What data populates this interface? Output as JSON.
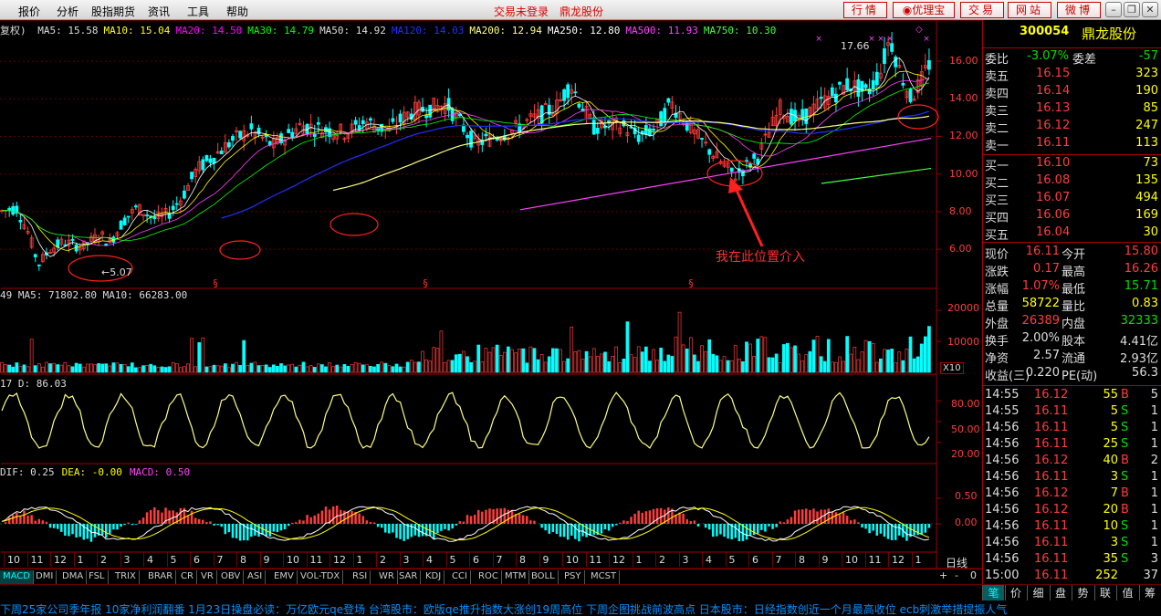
{
  "menu": [
    "报价",
    "分析",
    "股指期货",
    "资讯",
    "工具",
    "帮助"
  ],
  "header": {
    "login_status": "交易未登录",
    "stock_name": "鼎龙股份"
  },
  "toolbar": {
    "quote": "行情",
    "logo": "优理宝",
    "trade": "交易",
    "site": "网站",
    "weibo": "微博"
  },
  "ma_line": [
    {
      "text": "复权) ",
      "color": "#dddddd"
    },
    {
      "text": "MA5: 15.58",
      "color": "#dddddd"
    },
    {
      "text": "MA10: 15.04",
      "color": "#ffff00"
    },
    {
      "text": "MA20: 14.50",
      "color": "#ff00ff"
    },
    {
      "text": "MA30: 14.79",
      "color": "#00ff00"
    },
    {
      "text": "MA50: 14.92",
      "color": "#dddddd"
    },
    {
      "text": "MA120: 14.03",
      "color": "#2030ff"
    },
    {
      "text": "MA200: 12.94",
      "color": "#ffff80"
    },
    {
      "text": "MA250: 12.80",
      "color": "#ffffff"
    },
    {
      "text": "MA500: 11.93",
      "color": "#ff40ff"
    },
    {
      "text": "MA750: 10.30",
      "color": "#40ff40"
    }
  ],
  "price_axis": [
    "16.00",
    "14.00",
    "12.00",
    "10.00",
    "8.00",
    "6.00"
  ],
  "high_label": "17.66",
  "low_label": "5.07",
  "annotation": "我在此位置介入",
  "vol_line": "49  MA5: 71802.80  MA10: 66283.00",
  "vol_axis": [
    "20000",
    "10000"
  ],
  "vol_unit": "X10",
  "kdj_line": "17  D: 86.03",
  "kdj_axis": [
    "80.00",
    "50.00",
    "20.00"
  ],
  "macd_line": [
    {
      "text": "DIF: 0.25",
      "color": "#dddddd"
    },
    {
      "text": "DEA: -0.00",
      "color": "#ffff00"
    },
    {
      "text": "MACD: 0.50",
      "color": "#ff40ff"
    }
  ],
  "macd_axis": [
    "0.50",
    "0.00"
  ],
  "months": [
    "10",
    "11",
    "12",
    "1",
    "2",
    "3",
    "4",
    "5",
    "6",
    "7",
    "8",
    "9",
    "10",
    "11",
    "12",
    "1",
    "2",
    "3",
    "4",
    "5",
    "6",
    "7",
    "8",
    "9",
    "10",
    "11",
    "12",
    "1",
    "2",
    "3",
    "4",
    "5",
    "6",
    "7",
    "8",
    "9",
    "10",
    "11",
    "12",
    "1"
  ],
  "period_label": "日线",
  "bottom_tabs": [
    "MACD",
    "DMI",
    "DMA",
    "FSL",
    "TRIX",
    "BRAR",
    "CR",
    "VR",
    "OBV",
    "ASI",
    "EMV",
    "VOL-TDX",
    "RSI",
    "WR",
    "SAR",
    "KDJ",
    "CCI",
    "ROC",
    "MTM",
    "BOLL",
    "PSY",
    "MCST"
  ],
  "zoom_buttons": [
    "+",
    "-",
    "0"
  ],
  "quote": {
    "code": "300054",
    "name": "鼎龙股份",
    "weibi_label": "委比",
    "weibi": "-3.07%",
    "weicha_label": "委差",
    "weicha": "-57",
    "asks": [
      {
        "label": "卖五",
        "price": "16.15",
        "vol": "323"
      },
      {
        "label": "卖四",
        "price": "16.14",
        "vol": "190"
      },
      {
        "label": "卖三",
        "price": "16.13",
        "vol": "85"
      },
      {
        "label": "卖二",
        "price": "16.12",
        "vol": "247"
      },
      {
        "label": "卖一",
        "price": "16.11",
        "vol": "113"
      }
    ],
    "bids": [
      {
        "label": "买一",
        "price": "16.10",
        "vol": "73"
      },
      {
        "label": "买二",
        "price": "16.08",
        "vol": "135"
      },
      {
        "label": "买三",
        "price": "16.07",
        "vol": "494"
      },
      {
        "label": "买四",
        "price": "16.06",
        "vol": "169"
      },
      {
        "label": "买五",
        "price": "16.04",
        "vol": "30"
      }
    ],
    "stats": [
      {
        "l1": "现价",
        "v1": "16.11",
        "c1": "red",
        "l2": "今开",
        "v2": "15.80",
        "c2": "red"
      },
      {
        "l1": "涨跌",
        "v1": "0.17",
        "c1": "red",
        "l2": "最高",
        "v2": "16.26",
        "c2": "red"
      },
      {
        "l1": "涨幅",
        "v1": "1.07%",
        "c1": "red",
        "l2": "最低",
        "v2": "15.71",
        "c2": "green"
      },
      {
        "l1": "总量",
        "v1": "58722",
        "c1": "yellow",
        "l2": "量比",
        "v2": "0.83",
        "c2": "yellow"
      },
      {
        "l1": "外盘",
        "v1": "26389",
        "c1": "red",
        "l2": "内盘",
        "v2": "32333",
        "c2": "green"
      },
      {
        "l1": "换手",
        "v1": "2.00%",
        "c1": "white",
        "l2": "股本",
        "v2": "4.41亿",
        "c2": "white"
      },
      {
        "l1": "净资",
        "v1": "2.57",
        "c1": "white",
        "l2": "流通",
        "v2": "2.93亿",
        "c2": "white"
      },
      {
        "l1": "收益(三)",
        "v1": "0.220",
        "c1": "white",
        "l2": "PE(动)",
        "v2": "56.3",
        "c2": "white"
      }
    ],
    "ticks": [
      {
        "t": "14:55",
        "p": "16.12",
        "pc": "red",
        "v": "55",
        "d": "B",
        "n": "5"
      },
      {
        "t": "14:55",
        "p": "16.11",
        "pc": "red",
        "v": "5",
        "d": "S",
        "n": "1"
      },
      {
        "t": "14:56",
        "p": "16.11",
        "pc": "red",
        "v": "5",
        "d": "S",
        "n": "1"
      },
      {
        "t": "14:56",
        "p": "16.11",
        "pc": "red",
        "v": "25",
        "d": "S",
        "n": "1"
      },
      {
        "t": "14:56",
        "p": "16.12",
        "pc": "red",
        "v": "40",
        "d": "B",
        "n": "2"
      },
      {
        "t": "14:56",
        "p": "16.11",
        "pc": "red",
        "v": "3",
        "d": "S",
        "n": "1"
      },
      {
        "t": "14:56",
        "p": "16.12",
        "pc": "red",
        "v": "7",
        "d": "B",
        "n": "1"
      },
      {
        "t": "14:56",
        "p": "16.12",
        "pc": "red",
        "v": "20",
        "d": "B",
        "n": "1"
      },
      {
        "t": "14:56",
        "p": "16.11",
        "pc": "red",
        "v": "10",
        "d": "S",
        "n": "1"
      },
      {
        "t": "14:56",
        "p": "16.11",
        "pc": "red",
        "v": "3",
        "d": "S",
        "n": "1"
      },
      {
        "t": "14:56",
        "p": "16.11",
        "pc": "red",
        "v": "35",
        "d": "S",
        "n": "3"
      },
      {
        "t": "15:00",
        "p": "16.11",
        "pc": "red",
        "v": "252",
        "d": "",
        "n": "37"
      }
    ],
    "side_tabs": [
      "笔",
      "价",
      "细",
      "盘",
      "势",
      "联",
      "值",
      "筹"
    ]
  },
  "ticker": "下周25家公司季年报 10家净利润翻番        1月23日操盘必读：万亿欧元qe登场        台湾股市：欧版qe推升指数大涨创19周高位 下周企图挑战前波高点        日本股市：日经指数创近一个月最高收位 ecb刺激举措提振人气",
  "chart_data": {
    "type": "candlestick",
    "title": "",
    "ylim": [
      4.5,
      17.8
    ],
    "yticks": [
      6,
      8,
      10,
      12,
      14,
      16
    ],
    "ma_values": {
      "MA5": 15.58,
      "MA10": 15.04,
      "MA20": 14.5,
      "MA30": 14.79,
      "MA50": 14.92,
      "MA120": 14.03,
      "MA200": 12.94,
      "MA250": 12.8,
      "MA500": 11.93,
      "MA750": 10.3
    },
    "high": 17.66,
    "low": 5.07,
    "last": 16.11,
    "volume_ma": {
      "MA5": 71802.8,
      "MA10": 66283.0
    },
    "kdj_d": 86.03,
    "macd": {
      "DIF": 0.25,
      "DEA": -0.0,
      "MACD": 0.5
    }
  },
  "colors": {
    "up": "#ff3c3c",
    "down": "#00ffff",
    "frame": "#a00000",
    "grid": "#600000"
  }
}
